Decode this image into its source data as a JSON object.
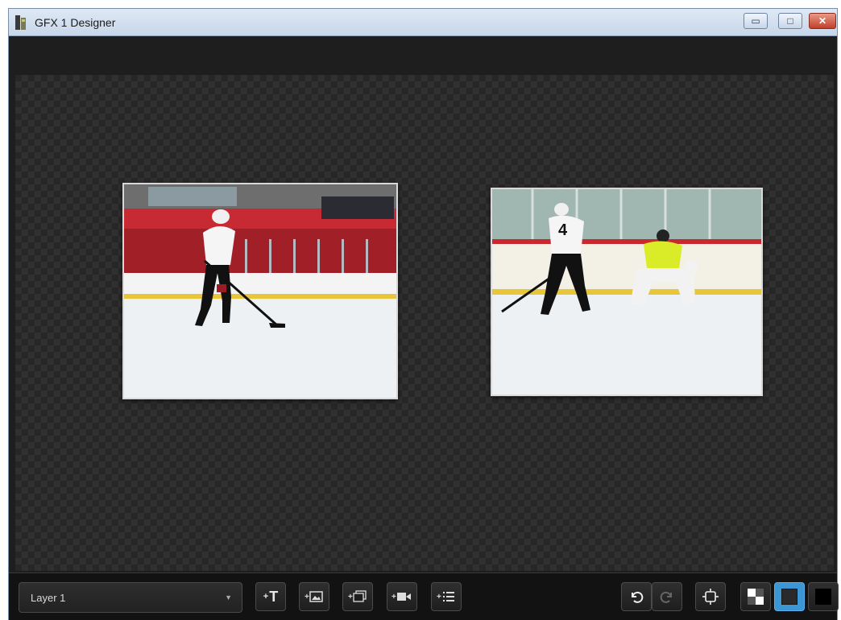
{
  "window": {
    "title": "GFX 1 Designer",
    "icon": "app-icon",
    "controls": [
      "minimize-icon",
      "maximize-icon",
      "close-icon"
    ]
  },
  "canvas": {
    "background": "checkerboard-transparent",
    "layers": [
      {
        "type": "image",
        "subject": "hockey skater with stick on ice"
      },
      {
        "type": "image",
        "subject": "hockey player #4 facing goaltender in yellow"
      }
    ]
  },
  "photo2_jersey": "4",
  "toolbar": {
    "layer_selector": {
      "value": "Layer 1"
    },
    "add_buttons": [
      "add-text-icon",
      "add-image-icon",
      "add-image-sequence-icon",
      "add-video-icon",
      "add-list-icon"
    ],
    "undo_enabled": true,
    "redo_enabled": false,
    "fit_icon": "fit-to-screen-icon",
    "background_modes": [
      "transparent-checker",
      "dark-gray",
      "black"
    ],
    "selected_background": "dark-gray",
    "accent_color": "#3d96d4"
  }
}
